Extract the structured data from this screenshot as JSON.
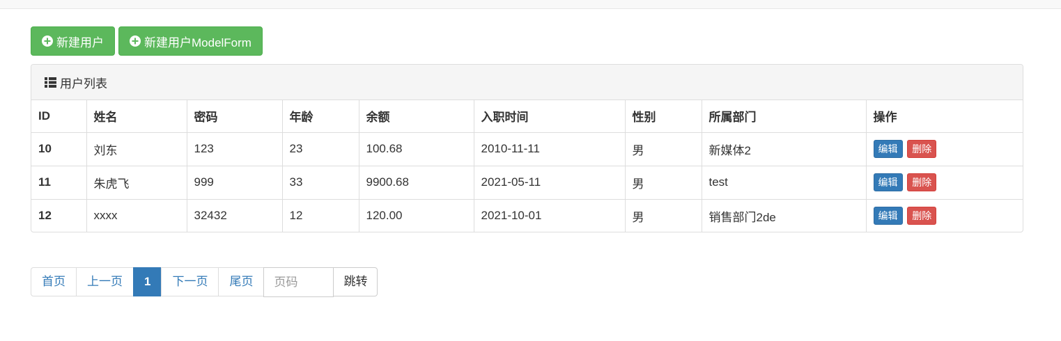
{
  "toolbar": {
    "new_user_label": "新建用户",
    "new_user_modelform_label": "新建用户ModelForm"
  },
  "panel": {
    "title": "用户列表"
  },
  "table": {
    "headers": [
      "ID",
      "姓名",
      "密码",
      "年龄",
      "余额",
      "入职时间",
      "性别",
      "所属部门",
      "操作"
    ],
    "rows": [
      {
        "id": "10",
        "name": "刘东",
        "password": "123",
        "age": "23",
        "balance": "100.68",
        "join_date": "2010-11-11",
        "gender": "男",
        "department": "新媒体2"
      },
      {
        "id": "11",
        "name": "朱虎飞",
        "password": "999",
        "age": "33",
        "balance": "9900.68",
        "join_date": "2021-05-11",
        "gender": "男",
        "department": "test"
      },
      {
        "id": "12",
        "name": "xxxx",
        "password": "32432",
        "age": "12",
        "balance": "120.00",
        "join_date": "2021-10-01",
        "gender": "男",
        "department": "销售部门2de"
      }
    ],
    "edit_label": "编辑",
    "delete_label": "删除"
  },
  "pagination": {
    "first": "首页",
    "prev": "上一页",
    "current": "1",
    "next": "下一页",
    "last": "尾页",
    "page_placeholder": "页码",
    "go_label": "跳转"
  },
  "colors": {
    "success": "#5cb85c",
    "primary": "#337ab7",
    "danger": "#d9534f"
  },
  "icons": {
    "new_user": "plus-circle-icon",
    "panel": "list-icon"
  }
}
